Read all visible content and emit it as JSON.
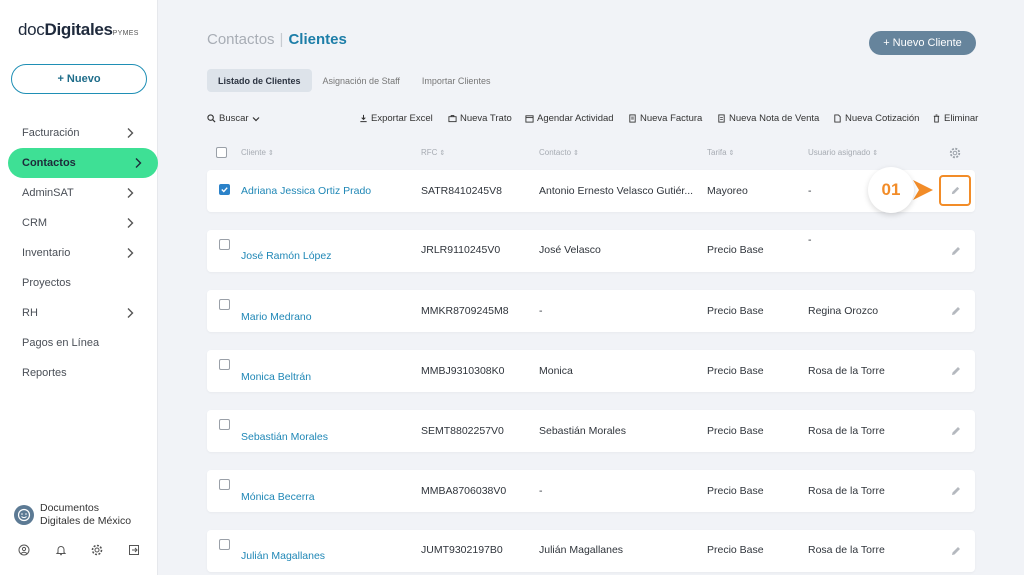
{
  "app": {
    "logo_main": "doc",
    "logo_bold": "Digitales",
    "logo_suffix": "PYMES",
    "new_button": "+ Nuevo"
  },
  "sidebar": {
    "items": [
      {
        "label": "Facturación",
        "chevron": true
      },
      {
        "label": "Contactos",
        "chevron": true,
        "active": true
      },
      {
        "label": "AdminSAT",
        "chevron": true
      },
      {
        "label": "CRM",
        "chevron": true
      },
      {
        "label": "Inventario",
        "chevron": true
      },
      {
        "label": "Proyectos",
        "chevron": false
      },
      {
        "label": "RH",
        "chevron": true
      },
      {
        "label": "Pagos en Línea",
        "chevron": false
      },
      {
        "label": "Reportes",
        "chevron": false
      }
    ],
    "company_line1": "Documentos",
    "company_line2": "Digitales de México",
    "bottom_icons": [
      "user-icon",
      "bell-icon",
      "gear-icon",
      "logout-icon"
    ]
  },
  "header": {
    "crumb1": "Contactos",
    "separator": "|",
    "crumb2": "Clientes",
    "new_client": "+ Nuevo Cliente"
  },
  "tabs": [
    {
      "label": "Listado de Clientes",
      "active": true
    },
    {
      "label": "Asignación de Staff",
      "active": false
    },
    {
      "label": "Importar Clientes",
      "active": false
    }
  ],
  "toolbar": {
    "search": "Buscar",
    "export": "Exportar Excel",
    "new_deal": "Nueva Trato",
    "schedule": "Agendar Actividad",
    "new_invoice": "Nueva Factura",
    "new_sale_note": "Nueva Nota de Venta",
    "new_quote": "Nueva Cotización",
    "delete": "Eliminar"
  },
  "table": {
    "columns": [
      "Cliente",
      "RFC",
      "Contacto",
      "Tarifa",
      "Usuario asignado"
    ],
    "rows": [
      {
        "cliente": "Adriana Jessica Ortiz Prado",
        "rfc": "SATR8410245V8",
        "contacto": "Antonio Ernesto Velasco Gutiér...",
        "tarifa": "Mayoreo",
        "usuario": "-",
        "checked": true
      },
      {
        "cliente": "José Ramón López",
        "rfc": "JRLR9110245V0",
        "contacto": "José Velasco",
        "tarifa": "Precio Base",
        "usuario": "-",
        "checked": false
      },
      {
        "cliente": "Mario Medrano",
        "rfc": "MMKR8709245M8",
        "contacto": "-",
        "tarifa": "Precio Base",
        "usuario": "Regina Orozco",
        "checked": false
      },
      {
        "cliente": "Monica Beltrán",
        "rfc": "MMBJ9310308K0",
        "contacto": "Monica",
        "tarifa": "Precio Base",
        "usuario": "Rosa de la Torre",
        "checked": false
      },
      {
        "cliente": "Sebastián Morales",
        "rfc": "SEMT8802257V0",
        "contacto": "Sebastián Morales",
        "tarifa": "Precio Base",
        "usuario": "Rosa de la Torre",
        "checked": false
      },
      {
        "cliente": "Mónica Becerra",
        "rfc": "MMBA8706038V0",
        "contacto": "-",
        "tarifa": "Precio Base",
        "usuario": "Rosa de la Torre",
        "checked": false
      },
      {
        "cliente": "Julián Magallanes",
        "rfc": "JUMT9302197B0",
        "contacto": "Julián Magallanes",
        "tarifa": "Precio Base",
        "usuario": "Rosa de la Torre",
        "checked": false
      }
    ]
  },
  "annotation": {
    "step": "01",
    "color": "#f28c28"
  }
}
